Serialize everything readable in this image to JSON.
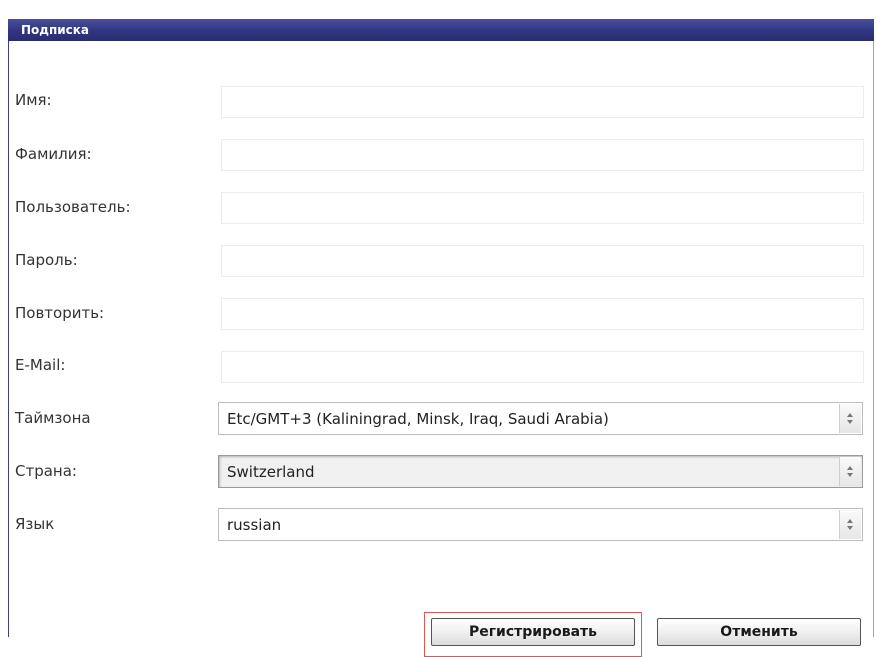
{
  "window": {
    "title": "Подписка"
  },
  "form": {
    "labels": {
      "first_name": "Имя:",
      "last_name": "Фамилия:",
      "username": "Пользователь:",
      "password": "Пароль:",
      "repeat": "Повторить:",
      "email": "E-Mail:",
      "timezone": "Таймзона",
      "country": "Страна:",
      "language": "Язык"
    },
    "values": {
      "first_name": "",
      "last_name": "",
      "username": "",
      "password": "",
      "repeat": "",
      "email": ""
    },
    "selects": {
      "timezone": "Etc/GMT+3 (Kaliningrad, Minsk, Iraq, Saudi Arabia)",
      "country": "Switzerland",
      "language": "russian"
    }
  },
  "buttons": {
    "register": "Регистрировать",
    "cancel": "Отменить"
  },
  "colors": {
    "titlebar": "#2f3580",
    "highlight": "#e05555"
  }
}
